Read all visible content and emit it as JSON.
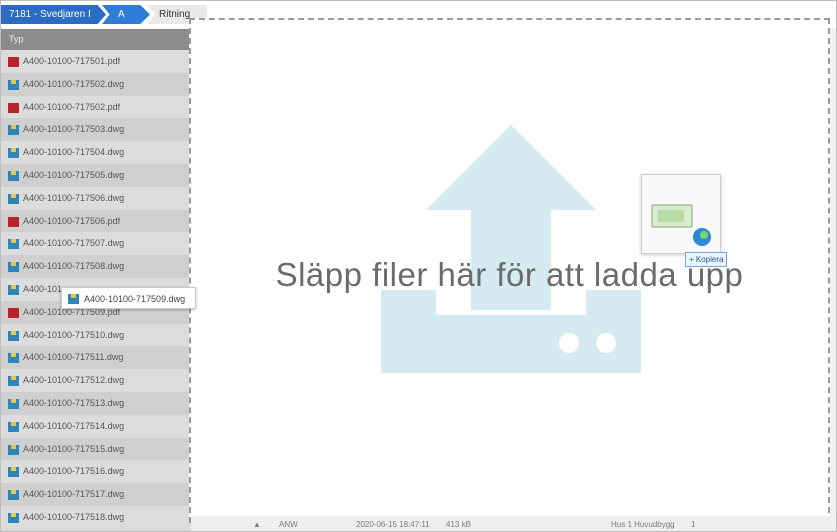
{
  "breadcrumb": {
    "items": [
      "7181 - Svedjaren I",
      "A",
      "Ritning"
    ]
  },
  "file_list": {
    "header": "Typ",
    "files": [
      {
        "name": "A400-10100-717501.pdf",
        "type": "pdf"
      },
      {
        "name": "A400-10100-717502.dwg",
        "type": "dwg"
      },
      {
        "name": "A400-10100-717502.pdf",
        "type": "pdf"
      },
      {
        "name": "A400-10100-717503.dwg",
        "type": "dwg"
      },
      {
        "name": "A400-10100-717504.dwg",
        "type": "dwg"
      },
      {
        "name": "A400-10100-717505.dwg",
        "type": "dwg"
      },
      {
        "name": "A400-10100-717506.dwg",
        "type": "dwg"
      },
      {
        "name": "A400-10100-717506.pdf",
        "type": "pdf"
      },
      {
        "name": "A400-10100-717507.dwg",
        "type": "dwg"
      },
      {
        "name": "A400-10100-717508.dwg",
        "type": "dwg"
      },
      {
        "name": "A400-101",
        "type": "dwg"
      },
      {
        "name": "A400-10100-717509.pdf",
        "type": "pdf"
      },
      {
        "name": "A400-10100-717510.dwg",
        "type": "dwg"
      },
      {
        "name": "A400-10100-717511.dwg",
        "type": "dwg"
      },
      {
        "name": "A400-10100-717512.dwg",
        "type": "dwg"
      },
      {
        "name": "A400-10100-717513.dwg",
        "type": "dwg"
      },
      {
        "name": "A400-10100-717514.dwg",
        "type": "dwg"
      },
      {
        "name": "A400-10100-717515.dwg",
        "type": "dwg"
      },
      {
        "name": "A400-10100-717516.dwg",
        "type": "dwg"
      },
      {
        "name": "A400-10100-717517.dwg",
        "type": "dwg"
      },
      {
        "name": "A400-10100-717518.dwg",
        "type": "dwg"
      }
    ]
  },
  "drop_zone": {
    "message": "Släpp filer här för att ladda upp",
    "icon": "upload-icon",
    "icon_color": "#d6eaf1"
  },
  "drag": {
    "filename": "A400-10100-717509.dwg",
    "badge": "+ Kopiera"
  },
  "footer": {
    "user": "ANW",
    "date": "2020-06-15 18:47:11",
    "size": "413 kB",
    "building": "Hus 1 Huvudbygg",
    "count": "1"
  },
  "colors": {
    "accent": "#2a6cc4",
    "pdf": "#b8232a",
    "dwg": "#2e86b8"
  }
}
